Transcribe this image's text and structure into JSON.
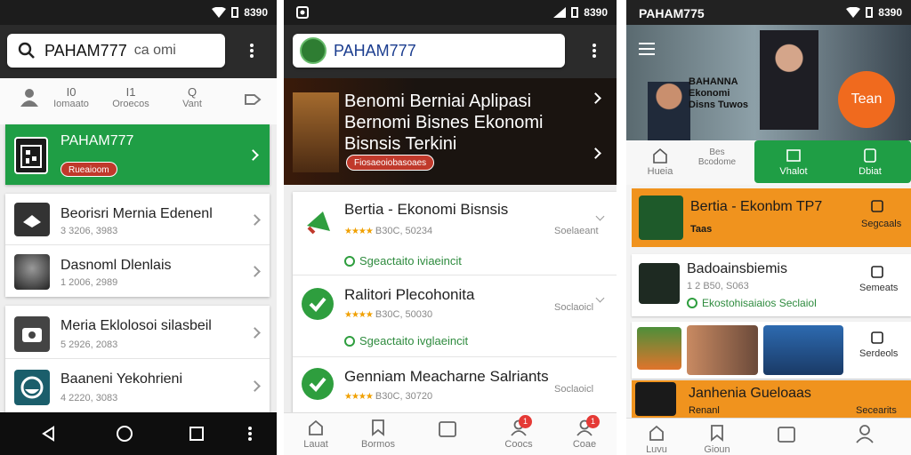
{
  "phone1": {
    "status_time": "8390",
    "search": {
      "value": "PAHAM777",
      "placeholder": "ca omi"
    },
    "tabs": [
      {
        "label": "Iomaato"
      },
      {
        "label": "Oroecos"
      },
      {
        "label": "Vant"
      }
    ],
    "featured": {
      "title": "PAHAM777",
      "badge": "Rueaioom",
      "color": "#1f9e45"
    },
    "items": [
      {
        "title": "Beorisri Mernia Edenenl",
        "sub": "3 3206, 3983"
      },
      {
        "title": "Dasnoml Dlenlais",
        "sub": "1 2006, 2989"
      },
      {
        "title": "Meria Eklolosoi silasbeil",
        "sub": "5 2926, 2083"
      },
      {
        "title": "Baaneni Yekohrieni",
        "sub": "4 2220, 3083"
      }
    ]
  },
  "phone2": {
    "status_time": "8390",
    "search": {
      "value": "PAHAM777"
    },
    "hero": {
      "title": "Benomi Berniai Aplipasi Bernomi Bisnes Ekonomi Bisnsis Terkini",
      "badge": "Fiosaeoiobasoaes"
    },
    "list": [
      {
        "title": "Bertia - Ekonomi Bisnsis",
        "rating": "★★★★",
        "meta": "B30C, 50234",
        "side": "Soelaeant",
        "link": "Sgeactaito iviaeincit"
      },
      {
        "title": "Ralitori Plecohonita",
        "rating": "★★★★",
        "meta": "B30C, 50030",
        "side": "Soclaoicl",
        "link": "Sgeactaito ivglaeincit"
      },
      {
        "title": "Genniam Meacharne Salriants",
        "rating": "★★★★",
        "meta": "B30C, 30720",
        "side": "Soclaoicl"
      }
    ],
    "nav": [
      {
        "label": "Lauat"
      },
      {
        "label": "Bormos"
      },
      {
        "label": ""
      },
      {
        "label": "Coocs",
        "badge": "1"
      },
      {
        "label": "Coae",
        "badge": "1"
      }
    ]
  },
  "phone3": {
    "status_time": "8390",
    "app_title": "PAHAM775",
    "banner": {
      "title": "BAHANNA Ekonomi Disns Tuwos",
      "cta": "Tean"
    },
    "tabs": [
      {
        "label": "Hueia"
      },
      {
        "label": "Bes Bcodome"
      },
      {
        "label": "Vhalot"
      },
      {
        "label": "Dbiat"
      }
    ],
    "items": [
      {
        "title": "Bertia - Ekonbm TP7",
        "sub": "Taas",
        "side": "Segcaals",
        "accent": "#f0931e"
      },
      {
        "title": "Badoainsbiemis",
        "sub": "1 2 B50, S063",
        "link": "Ekostohisaiaios Seclaiol",
        "side": "Semeats"
      },
      {
        "title": "",
        "side": "Serdeols"
      },
      {
        "title": "Janhenia Gueloaas",
        "sub": "Renanl",
        "side": "Secearits",
        "accent": "#f0931e"
      }
    ],
    "nav": [
      {
        "label": "Luvu"
      },
      {
        "label": "Gioun"
      },
      {
        "label": ""
      },
      {
        "label": ""
      }
    ]
  },
  "colors": {
    "green": "#1f9e45",
    "orange": "#f0931e",
    "dark": "#1c1c1c"
  }
}
